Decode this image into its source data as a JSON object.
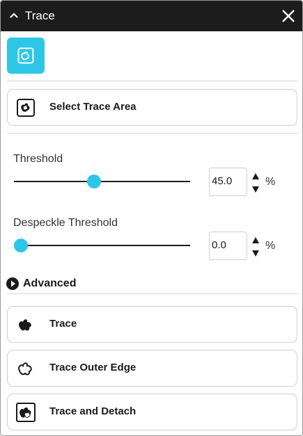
{
  "panel": {
    "title": "Trace",
    "icons": {
      "collapse": "chevron-up-icon",
      "close": "close-icon",
      "tool": "trace-tool-icon"
    }
  },
  "select_area": {
    "label": "Select Trace Area",
    "icon": "select-area-icon"
  },
  "threshold": {
    "label": "Threshold",
    "value": "45.0",
    "unit": "%",
    "slider_fraction": 0.45
  },
  "despeckle": {
    "label": "Despeckle Threshold",
    "value": "0.0",
    "unit": "%",
    "slider_fraction": 0.0
  },
  "advanced": {
    "label": "Advanced",
    "icon": "play-circle-icon"
  },
  "actions": [
    {
      "label": "Trace",
      "icon": "trace-blob-icon"
    },
    {
      "label": "Trace Outer Edge",
      "icon": "trace-outline-icon"
    },
    {
      "label": "Trace and Detach",
      "icon": "trace-detach-icon"
    }
  ],
  "colors": {
    "accent": "#2ec6e6",
    "titlebar": "#1c1c1c"
  }
}
